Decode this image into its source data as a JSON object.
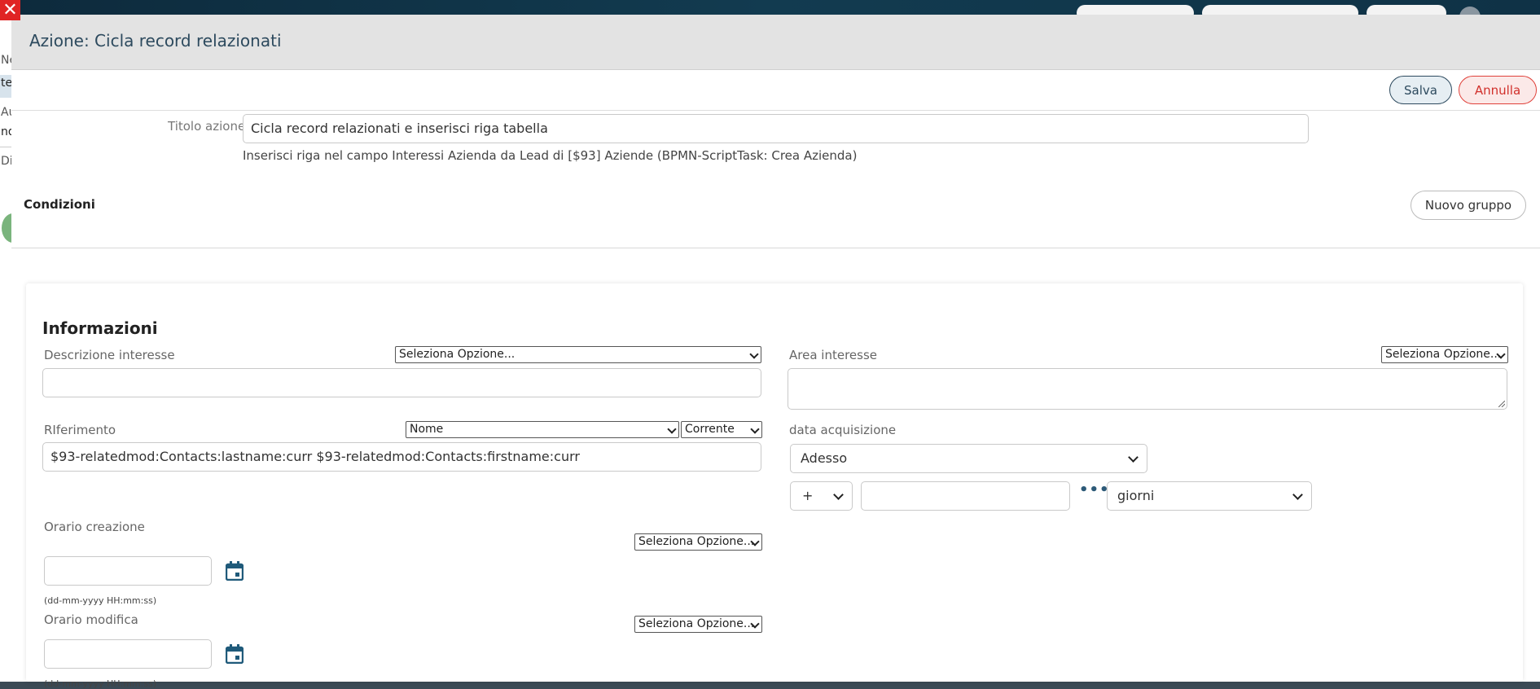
{
  "background_app": {
    "left_fragments": [
      "Ne",
      "te",
      "Au",
      "nd",
      "Di"
    ]
  },
  "icons": {
    "close": "close-icon",
    "calendar": "calendar-icon",
    "more": "more-dots-icon",
    "chevron": "chevron-down-icon"
  },
  "colors": {
    "header_bg": "#e3e3e3",
    "title_color": "#2d4a5e",
    "cancel_color": "#d1302b",
    "close_bg": "#e02424"
  },
  "modal": {
    "title": "Azione: Cicla record relazionati",
    "save_label": "Salva",
    "cancel_label": "Annulla"
  },
  "action_form": {
    "title_label": "Titolo azione",
    "title_value": "Cicla record relazionati e inserisci riga tabella",
    "description": "Inserisci riga nel campo Interessi Azienda da Lead di [$93] Aziende (BPMN-ScriptTask: Crea Azienda)"
  },
  "conditions": {
    "title": "Condizioni",
    "new_group_label": "Nuovo gruppo"
  },
  "info": {
    "title": "Informazioni",
    "descrizione_interesse": {
      "label": "Descrizione interesse",
      "select": "Seleziona Opzione...",
      "value": ""
    },
    "area_interesse": {
      "label": "Area interesse",
      "select": "Seleziona Opzione...",
      "value": ""
    },
    "riferimento": {
      "label": "RIferimento",
      "select_field": "Nome",
      "select_scope": "Corrente",
      "value": "$93-relatedmod:Contacts:lastname:curr $93-relatedmod:Contacts:firstname:curr"
    },
    "data_acquisizione": {
      "label": "data acquisizione",
      "select": "Adesso",
      "operator": "+",
      "amount": "",
      "unit": "giorni"
    },
    "orario_creazione": {
      "label": "Orario creazione",
      "select": "Seleziona Opzione...",
      "value": "",
      "hint": "(dd-mm-yyyy HH:mm:ss)"
    },
    "orario_modifica": {
      "label": "Orario modifica",
      "select": "Seleziona Opzione...",
      "value": "",
      "hint": "(dd-mm-yyyy HH:mm:ss)"
    }
  }
}
